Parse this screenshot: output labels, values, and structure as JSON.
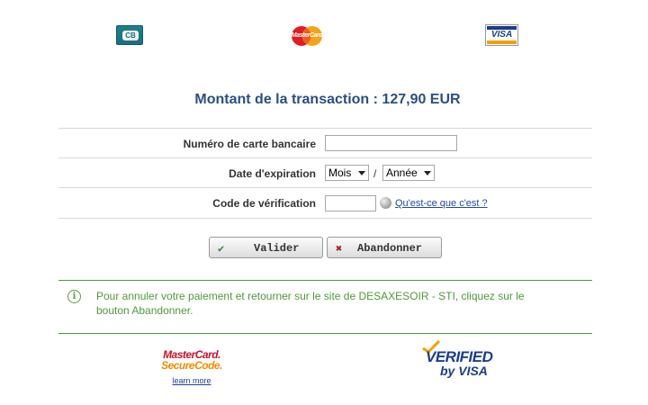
{
  "logos": {
    "cb": {
      "text": "CB"
    },
    "mastercard": {
      "text": "MasterCard"
    },
    "visa": {
      "text": "VISA"
    }
  },
  "title": "Montant de la transaction : 127,90 EUR",
  "form": {
    "card_number": {
      "label": "Numéro de carte bancaire",
      "value": ""
    },
    "expiry": {
      "label": "Date d'expiration",
      "month": {
        "selected": "Mois"
      },
      "separator": "/",
      "year": {
        "selected": "Année"
      }
    },
    "cvv": {
      "label": "Code de vérification",
      "value": "",
      "help_link": "Qu'est-ce que c'est ?"
    }
  },
  "buttons": {
    "validate": {
      "label": "Valider",
      "icon": "check-icon",
      "icon_color": "#2e8b2e"
    },
    "cancel": {
      "label": "Abandonner",
      "icon": "close-icon",
      "icon_color": "#b01c1c"
    }
  },
  "info": {
    "icon": "info-icon",
    "text": "Pour annuler votre paiement et retourner sur le site de DESAXESOIR - STI, cliquez sur le bouton Abandonner."
  },
  "footer": {
    "mastercard_securecode": {
      "line1": "MasterCard.",
      "line2": "SecureCode.",
      "learn_more": "learn more"
    },
    "verified_by_visa": {
      "line1": "VERIFIED",
      "line2": "by VISA"
    }
  },
  "colors": {
    "title": "#2b4f83",
    "info_green": "#4f9a3a",
    "link_blue": "#1f4aa8"
  }
}
